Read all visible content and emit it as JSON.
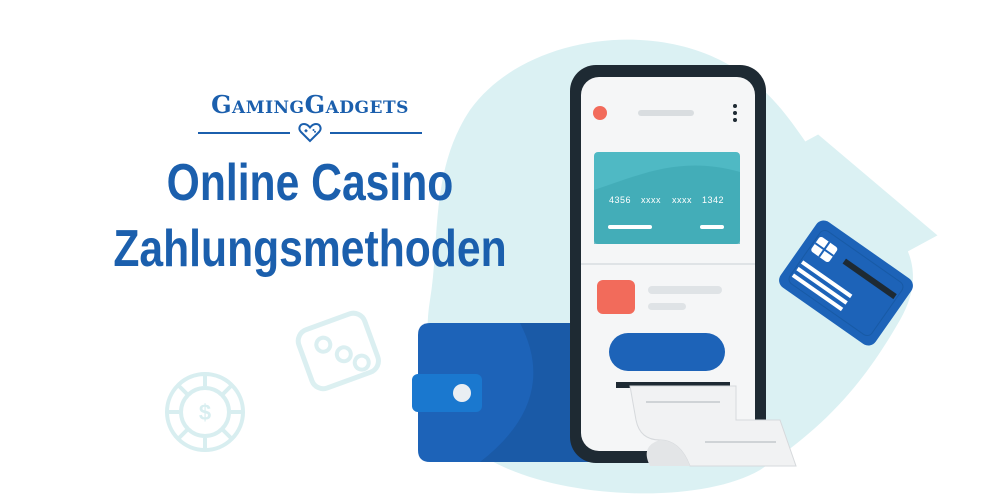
{
  "brand": {
    "name": "GamingGadgets"
  },
  "headline": {
    "line1": "Online Casino",
    "line2": "Zahlungsmethoden"
  },
  "card": {
    "number_groups": [
      "4356",
      "xxxx",
      "xxxx",
      "1342"
    ]
  },
  "colors": {
    "brand_blue": "#1b5fad",
    "light_teal": "#dbf1f3",
    "card_teal": "#4fb9c4",
    "accent_red": "#f26b5b",
    "wallet_blue": "#1d63b8",
    "phone_dark": "#1e2a33"
  },
  "icons": [
    "heart-gamepad-icon",
    "dice-icon",
    "casino-chip-icon",
    "menu-dots-icon"
  ]
}
